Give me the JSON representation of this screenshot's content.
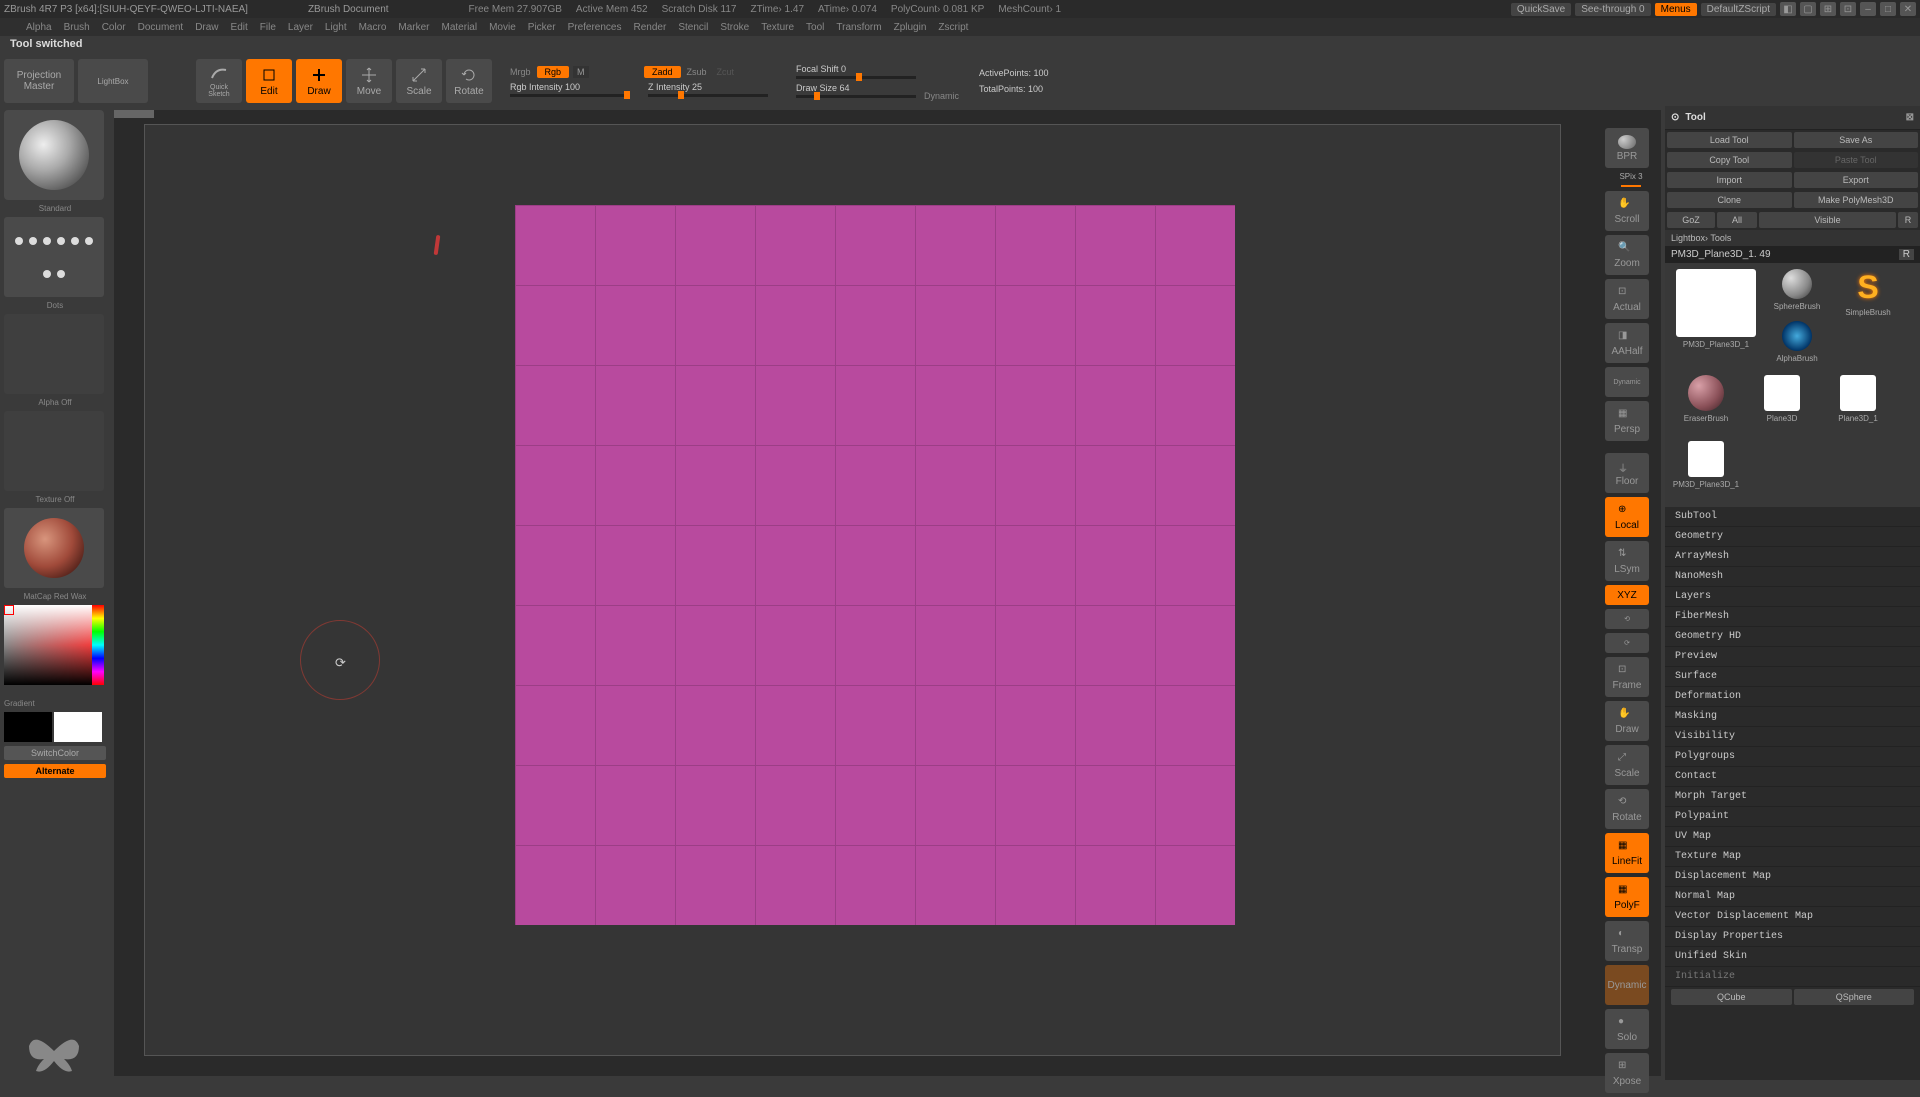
{
  "title_left": "ZBrush 4R7 P3 [x64]:[SIUH-QEYF-QWEO-LJTI-NAEA]",
  "title_center": "ZBrush Document",
  "stats": {
    "free_mem": "Free Mem 27.907GB",
    "active_mem": "Active Mem 452",
    "scratch": "Scratch Disk 117",
    "ztime": "ZTime› 1.47",
    "atime": "ATime› 0.074",
    "polycount": "PolyCount› 0.081 KP",
    "meshcount": "MeshCount› 1"
  },
  "title_right": {
    "quicksave": "QuickSave",
    "seethrough": "See-through  0",
    "menus": "Menus",
    "script": "DefaultZScript"
  },
  "menus": [
    "Alpha",
    "Brush",
    "Color",
    "Document",
    "Draw",
    "Edit",
    "File",
    "Layer",
    "Light",
    "Macro",
    "Marker",
    "Material",
    "Movie",
    "Picker",
    "Preferences",
    "Render",
    "Stencil",
    "Stroke",
    "Texture",
    "Tool",
    "Transform",
    "Zplugin",
    "Zscript"
  ],
  "status": "Tool switched",
  "toolbar": {
    "projection": "Projection\nMaster",
    "lightbox": "LightBox",
    "quicksketch": "Quick\nSketch",
    "edit": "Edit",
    "draw": "Draw",
    "move": "Move",
    "scale": "Scale",
    "rotate": "Rotate",
    "mrgb": "Mrgb",
    "rgb": "Rgb",
    "m": "M",
    "rgb_intensity": "Rgb Intensity 100",
    "zadd": "Zadd",
    "zsub": "Zsub",
    "zcut": "Zcut",
    "z_intensity": "Z Intensity 25",
    "focal": "Focal Shift 0",
    "draw_size": "Draw Size 64",
    "dynamic": "Dynamic",
    "active_pts": "ActivePoints: 100",
    "total_pts": "TotalPoints: 100"
  },
  "left": {
    "brush": "Standard",
    "stroke": "Dots",
    "alpha": "Alpha Off",
    "texture": "Texture Off",
    "material": "MatCap Red Wax",
    "gradient": "Gradient",
    "switchcolor": "SwitchColor",
    "alternate": "Alternate"
  },
  "right_side": {
    "spix": "SPix 3",
    "items": [
      "BPR",
      "Scroll",
      "Zoom",
      "Actual",
      "AAHalf",
      "Persp",
      "Floor",
      "Local",
      "LSym",
      "XYZ",
      "Frame",
      "Draw",
      "Scale",
      "Rotate",
      "LineFit",
      "PolyF",
      "Transp",
      "Dynamic",
      "Solo",
      "Xpose"
    ]
  },
  "tool_panel": {
    "header": "Tool",
    "rows": [
      [
        "Load Tool",
        "Save As"
      ],
      [
        "Copy Tool",
        "Paste Tool"
      ],
      [
        "Import",
        "Export"
      ],
      [
        "Clone",
        "Make PolyMesh3D"
      ]
    ],
    "goz": [
      "GoZ",
      "All",
      "Visible",
      "R"
    ],
    "lightbox_tools": "Lightbox› Tools",
    "current_tool": "PM3D_Plane3D_1. 49",
    "thumbs": [
      "PM3D_Plane3D_1",
      "SphereBrush",
      "AlphaBrush",
      "SimpleBrush",
      "EraserBrush",
      "Plane3D",
      "Plane3D_1",
      "PM3D_Plane3D_1"
    ],
    "sections": [
      "SubTool",
      "Geometry",
      "ArrayMesh",
      "NanoMesh",
      "Layers",
      "FiberMesh",
      "Geometry HD",
      "Preview",
      "Surface",
      "Deformation",
      "Masking",
      "Visibility",
      "Polygroups",
      "Contact",
      "Morph Target",
      "Polypaint",
      "UV Map",
      "Texture Map",
      "Displacement Map",
      "Normal Map",
      "Vector Displacement Map",
      "Display Properties",
      "Unified Skin",
      "Initialize"
    ],
    "init_buttons": [
      "QCube",
      "QSphere"
    ]
  }
}
